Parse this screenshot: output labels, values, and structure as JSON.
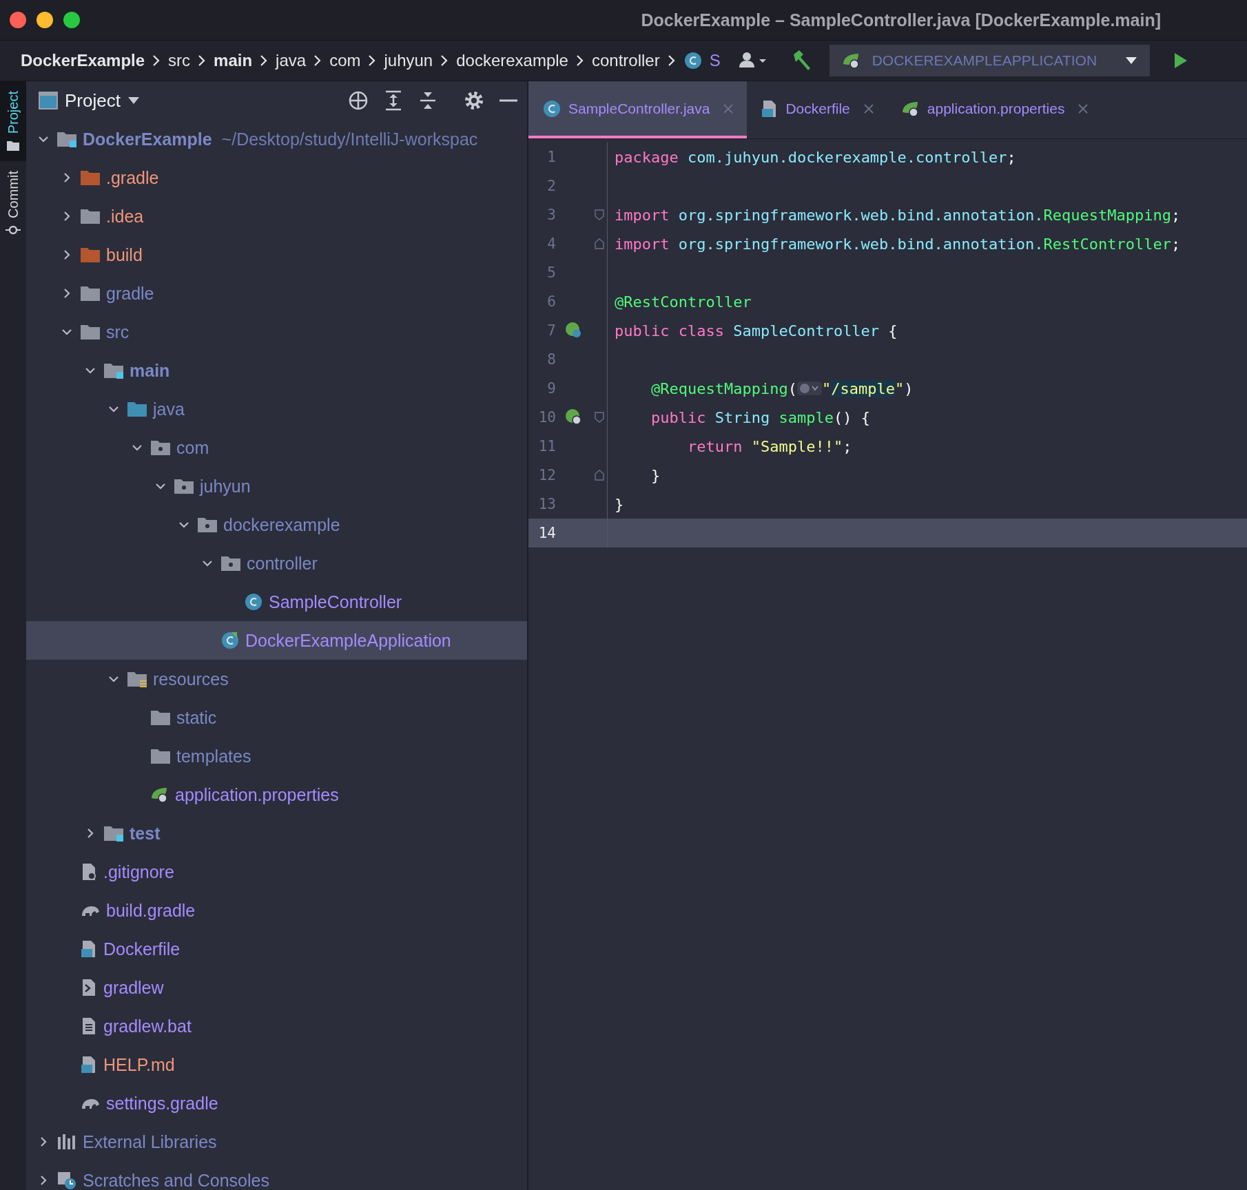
{
  "window": {
    "title": "DockerExample – SampleController.java [DockerExample.main]"
  },
  "breadcrumbs": [
    {
      "label": "DockerExample",
      "bold": true
    },
    {
      "label": "src",
      "bold": false
    },
    {
      "label": "main",
      "bold": true
    },
    {
      "label": "java",
      "bold": false
    },
    {
      "label": "com",
      "bold": false
    },
    {
      "label": "juhyun",
      "bold": false
    },
    {
      "label": "dockerexample",
      "bold": false
    },
    {
      "label": "controller",
      "bold": false
    }
  ],
  "breadcrumb_class": {
    "label": "S"
  },
  "run_config": {
    "label": "DOCKEREXAMPLEAPPLICATION"
  },
  "side_tabs": [
    {
      "label": "Project",
      "selected": true,
      "kind": "folder"
    },
    {
      "label": "Commit",
      "selected": false,
      "kind": "commit"
    }
  ],
  "project_panel": {
    "title": "Project",
    "tree": [
      {
        "name": "DockerExample",
        "path": "~/Desktop/study/IntelliJ-workspac",
        "kind": "module",
        "color": "#7b88c6",
        "bold": true,
        "expanded": true,
        "selected": false,
        "children": [
          {
            "name": ".gradle",
            "kind": "excluded",
            "color": "#f0967a",
            "bold": false,
            "expanded": false,
            "selected": false
          },
          {
            "name": ".idea",
            "kind": "folder",
            "color": "#f0967a",
            "bold": false,
            "expanded": false,
            "selected": false
          },
          {
            "name": "build",
            "kind": "excluded",
            "color": "#f0967a",
            "bold": false,
            "expanded": false,
            "selected": false
          },
          {
            "name": "gradle",
            "kind": "folder",
            "color": "#7b88c6",
            "bold": false,
            "expanded": false,
            "selected": false
          },
          {
            "name": "src",
            "kind": "folder",
            "color": "#7b88c6",
            "bold": false,
            "expanded": true,
            "selected": false,
            "children": [
              {
                "name": "main",
                "kind": "module",
                "color": "#7b88c6",
                "bold": true,
                "expanded": true,
                "selected": false,
                "children": [
                  {
                    "name": "java",
                    "kind": "source",
                    "color": "#7b88c6",
                    "bold": false,
                    "expanded": true,
                    "selected": false,
                    "children": [
                      {
                        "name": "com",
                        "kind": "package",
                        "color": "#7b88c6",
                        "bold": false,
                        "expanded": true,
                        "selected": false,
                        "children": [
                          {
                            "name": "juhyun",
                            "kind": "package",
                            "color": "#7b88c6",
                            "bold": false,
                            "expanded": true,
                            "selected": false,
                            "children": [
                              {
                                "name": "dockerexample",
                                "kind": "package",
                                "color": "#7b88c6",
                                "bold": false,
                                "expanded": true,
                                "selected": false,
                                "children": [
                                  {
                                    "name": "controller",
                                    "kind": "package",
                                    "color": "#7b88c6",
                                    "bold": false,
                                    "expanded": true,
                                    "selected": false,
                                    "children": [
                                      {
                                        "name": "SampleController",
                                        "kind": "class",
                                        "color": "#a58bff",
                                        "bold": false,
                                        "selected": false
                                      }
                                    ]
                                  },
                                  {
                                    "name": "DockerExampleApplication",
                                    "kind": "application",
                                    "color": "#a58bff",
                                    "bold": false,
                                    "selected": true
                                  }
                                ]
                              }
                            ]
                          }
                        ]
                      }
                    ]
                  },
                  {
                    "name": "resources",
                    "kind": "resources",
                    "color": "#7b88c6",
                    "bold": false,
                    "expanded": true,
                    "selected": false,
                    "children": [
                      {
                        "name": "static",
                        "kind": "folder",
                        "color": "#7b88c6",
                        "bold": false,
                        "selected": false
                      },
                      {
                        "name": "templates",
                        "kind": "folder",
                        "color": "#7b88c6",
                        "bold": false,
                        "selected": false
                      },
                      {
                        "name": "application.properties",
                        "kind": "properties",
                        "color": "#a58bff",
                        "bold": false,
                        "selected": false
                      }
                    ]
                  }
                ]
              },
              {
                "name": "test",
                "kind": "module",
                "color": "#7b88c6",
                "bold": true,
                "expanded": false,
                "selected": false
              }
            ]
          },
          {
            "name": ".gitignore",
            "kind": "ignore",
            "color": "#a58bff",
            "bold": false,
            "selected": false
          },
          {
            "name": "build.gradle",
            "kind": "gradle",
            "color": "#a58bff",
            "bold": false,
            "selected": false
          },
          {
            "name": "Dockerfile",
            "kind": "docker",
            "color": "#a58bff",
            "bold": false,
            "selected": false
          },
          {
            "name": "gradlew",
            "kind": "script",
            "color": "#a58bff",
            "bold": false,
            "selected": false
          },
          {
            "name": "gradlew.bat",
            "kind": "text",
            "color": "#a58bff",
            "bold": false,
            "selected": false
          },
          {
            "name": "HELP.md",
            "kind": "markdown",
            "color": "#f0967a",
            "bold": false,
            "selected": false
          },
          {
            "name": "settings.gradle",
            "kind": "gradle",
            "color": "#a58bff",
            "bold": false,
            "selected": false
          }
        ]
      },
      {
        "name": "External Libraries",
        "kind": "libraries",
        "color": "#7b88c6",
        "bold": false,
        "expanded": false,
        "selected": false
      },
      {
        "name": "Scratches and Consoles",
        "kind": "scratches",
        "color": "#7b88c6",
        "bold": false,
        "expanded": false,
        "selected": false
      }
    ]
  },
  "editor_tabs": [
    {
      "label": "SampleController.java",
      "kind": "class",
      "selected": true
    },
    {
      "label": "Dockerfile",
      "kind": "docker",
      "selected": false
    },
    {
      "label": "application.properties",
      "kind": "properties",
      "selected": false
    }
  ],
  "code": [
    {
      "number": "1",
      "current": false,
      "kind": "plain",
      "tokens": [
        {
          "text": "package ",
          "kind": "keyword"
        },
        {
          "text": "com.juhyun.dockerexample.controller",
          "kind": "ident"
        },
        {
          "text": ";",
          "kind": "plain"
        }
      ]
    },
    {
      "number": "2",
      "current": false,
      "kind": "plain"
    },
    {
      "number": "3",
      "current": false,
      "kind": "foldstart",
      "tokens": [
        {
          "text": "import ",
          "kind": "keyword"
        },
        {
          "text": "org.springframework.web.bind.annotation.",
          "kind": "ident"
        },
        {
          "text": "RequestMapping",
          "kind": "green"
        },
        {
          "text": ";",
          "kind": "plain"
        }
      ]
    },
    {
      "number": "4",
      "current": false,
      "kind": "foldend",
      "tokens": [
        {
          "text": "import ",
          "kind": "keyword"
        },
        {
          "text": "org.springframework.web.bind.annotation.",
          "kind": "ident"
        },
        {
          "text": "RestController",
          "kind": "green"
        },
        {
          "text": ";",
          "kind": "plain"
        }
      ]
    },
    {
      "number": "5",
      "current": false,
      "kind": "plain"
    },
    {
      "number": "6",
      "current": false,
      "kind": "plain",
      "tokens": [
        {
          "text": "@RestController",
          "kind": "green"
        }
      ]
    },
    {
      "number": "7",
      "current": false,
      "kind": "bean",
      "tokens": [
        {
          "text": "public class ",
          "kind": "keyword"
        },
        {
          "text": "SampleController ",
          "kind": "ident"
        },
        {
          "text": "{",
          "kind": "plain"
        }
      ]
    },
    {
      "number": "8",
      "current": false,
      "kind": "plain"
    },
    {
      "number": "9",
      "current": false,
      "kind": "plain",
      "tokens": [
        {
          "text": "    @RequestMapping",
          "kind": "green"
        },
        {
          "text": "(",
          "kind": "plain"
        },
        {
          "kind": "inlay"
        },
        {
          "text": "\"",
          "kind": "string"
        },
        {
          "text": "/sample",
          "kind": "selected"
        },
        {
          "text": "\"",
          "kind": "string"
        },
        {
          "text": ")",
          "kind": "plain"
        }
      ]
    },
    {
      "number": "10",
      "current": false,
      "kind": "endpoint",
      "tokens": [
        {
          "text": "    public ",
          "kind": "keyword"
        },
        {
          "text": "String ",
          "kind": "ident"
        },
        {
          "text": "sample",
          "kind": "green"
        },
        {
          "text": "() {",
          "kind": "plain"
        }
      ]
    },
    {
      "number": "11",
      "current": false,
      "kind": "plain",
      "tokens": [
        {
          "text": "        return ",
          "kind": "keyword"
        },
        {
          "text": "\"Sample!!\"",
          "kind": "string"
        },
        {
          "text": ";",
          "kind": "plain"
        }
      ]
    },
    {
      "number": "12",
      "current": false,
      "kind": "foldend",
      "tokens": [
        {
          "text": "    }",
          "kind": "plain"
        }
      ]
    },
    {
      "number": "13",
      "current": false,
      "kind": "plain",
      "tokens": [
        {
          "text": "}",
          "kind": "plain"
        }
      ]
    },
    {
      "number": "14",
      "current": true,
      "kind": "plain"
    }
  ]
}
